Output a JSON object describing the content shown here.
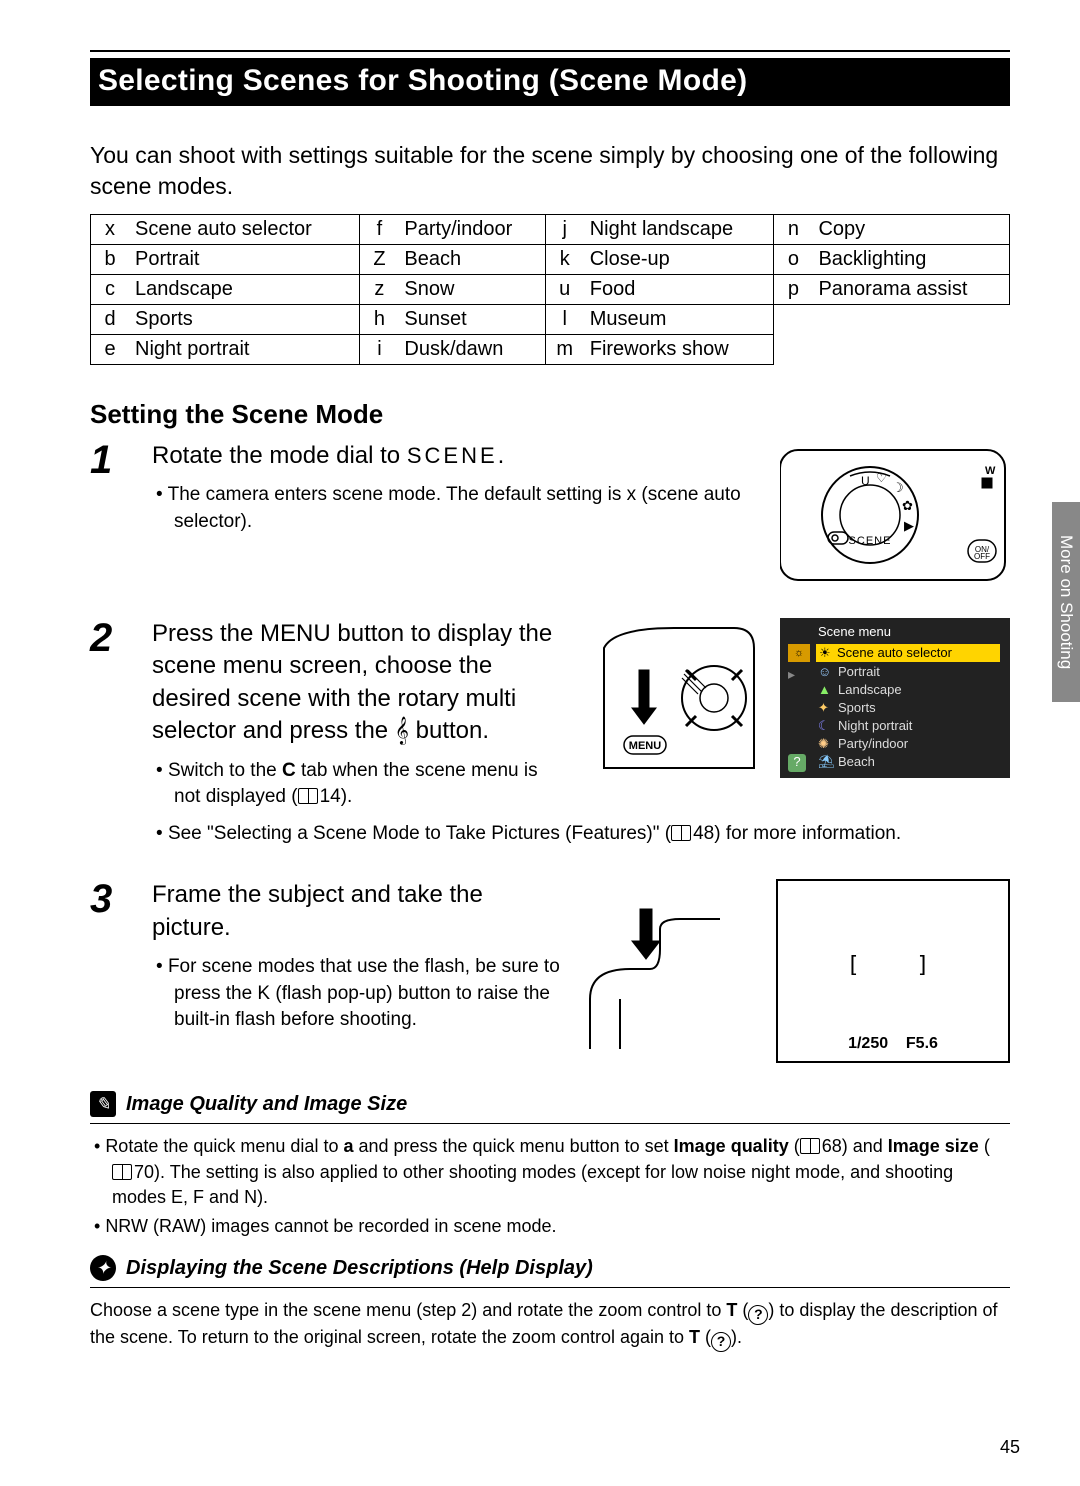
{
  "header": {
    "title": "Selecting Scenes for Shooting (Scene Mode)"
  },
  "intro": "You can shoot with settings suitable for the scene simply by choosing one of the following scene modes.",
  "scene_table": [
    [
      {
        "c": "x",
        "n": "Scene auto selector"
      },
      {
        "c": "f",
        "n": "Party/indoor"
      },
      {
        "c": "j",
        "n": "Night landscape"
      },
      {
        "c": "n",
        "n": "Copy"
      }
    ],
    [
      {
        "c": "b",
        "n": "Portrait"
      },
      {
        "c": "Z",
        "n": "Beach"
      },
      {
        "c": "k",
        "n": "Close-up"
      },
      {
        "c": "o",
        "n": "Backlighting"
      }
    ],
    [
      {
        "c": "c",
        "n": "Landscape"
      },
      {
        "c": "z",
        "n": "Snow"
      },
      {
        "c": "u",
        "n": "Food"
      },
      {
        "c": "p",
        "n": "Panorama assist"
      }
    ],
    [
      {
        "c": "d",
        "n": "Sports"
      },
      {
        "c": "h",
        "n": "Sunset"
      },
      {
        "c": "l",
        "n": "Museum"
      },
      {
        "c": "",
        "n": ""
      }
    ],
    [
      {
        "c": "e",
        "n": "Night portrait"
      },
      {
        "c": "i",
        "n": "Dusk/dawn"
      },
      {
        "c": "m",
        "n": "Fireworks show"
      },
      {
        "c": "",
        "n": ""
      }
    ]
  ],
  "subhead": "Setting the Scene Mode",
  "steps": {
    "s1": {
      "num": "1",
      "head_a": "Rotate the mode dial to ",
      "head_b": "SCENE",
      "head_c": ".",
      "bullets": [
        "The camera enters scene mode. The default setting is x (scene auto selector)."
      ]
    },
    "s2": {
      "num": "2",
      "head": "Press the MENU button to display the scene menu screen, choose the desired scene with the rotary multi selector and press the 𝄞 button.",
      "bullet1_a": "Switch to the ",
      "bullet1_b": "C",
      "bullet1_c": " tab when the scene menu is not displayed (",
      "bullet1_ref": "14",
      "bullet1_d": ").",
      "bullet2_a": "See \"Selecting a Scene Mode to Take Pictures (Features)\" (",
      "bullet2_ref": "48",
      "bullet2_b": ") for more information.",
      "lcd": {
        "header": "Scene menu",
        "rows": [
          "Scene auto selector",
          "Portrait",
          "Landscape",
          "Sports",
          "Night portrait",
          "Party/indoor",
          "Beach"
        ]
      },
      "menu_label": "MENU"
    },
    "s3": {
      "num": "3",
      "head": "Frame the subject and take the picture.",
      "bullet": "For scene modes that use the flash, be sure to press the K (flash pop-up) button to raise the built-in flash before shooting.",
      "shutter": "1/250",
      "aperture": "F5.6"
    }
  },
  "note1": {
    "icon": "✎",
    "title": "Image Quality and Image Size",
    "b1_a": "Rotate the quick menu dial to ",
    "b1_b": "a",
    "b1_c": " and press the quick menu button to set ",
    "b1_d": "Image quality",
    "b1_e": " (",
    "b1_ref1": "68",
    "b1_f": ") and ",
    "b1_g": "Image size",
    "b1_h": " (",
    "b1_ref2": "70",
    "b1_i": "). The setting is also applied to other shooting modes (except for low noise night mode, and shooting modes E, F and N).",
    "b2": "NRW (RAW) images cannot be recorded in scene mode."
  },
  "note2": {
    "icon": "✦",
    "title": "Displaying the Scene Descriptions (Help Display)",
    "body_a": "Choose a scene type in the scene menu (step 2) and rotate the zoom control to ",
    "body_b": "T",
    "body_c": " to display the description of the scene. To return to the original screen, rotate the zoom control again to ",
    "body_d": "T",
    "body_e": "."
  },
  "side_tab": "More on Shooting",
  "page_number": "45"
}
